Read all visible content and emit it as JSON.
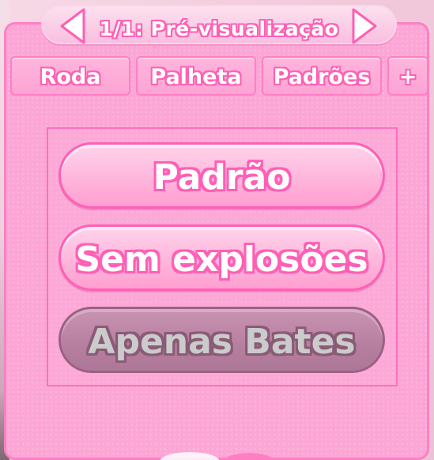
{
  "header": {
    "title": "1/1: Pré-visualização",
    "prev_icon": "chevron-left-icon",
    "next_icon": "chevron-right-icon"
  },
  "tabs": [
    {
      "label": "Roda"
    },
    {
      "label": "Palheta"
    },
    {
      "label": "Padrões"
    },
    {
      "label": "+"
    }
  ],
  "options": [
    {
      "label": "Padrão",
      "enabled": true
    },
    {
      "label": "Sem explosões",
      "enabled": true
    },
    {
      "label": "Apenas Bates",
      "enabled": false
    }
  ],
  "colors": {
    "panel": "#fca6d6",
    "accent": "#ff5fb5",
    "disabled": "#b77f9f"
  }
}
